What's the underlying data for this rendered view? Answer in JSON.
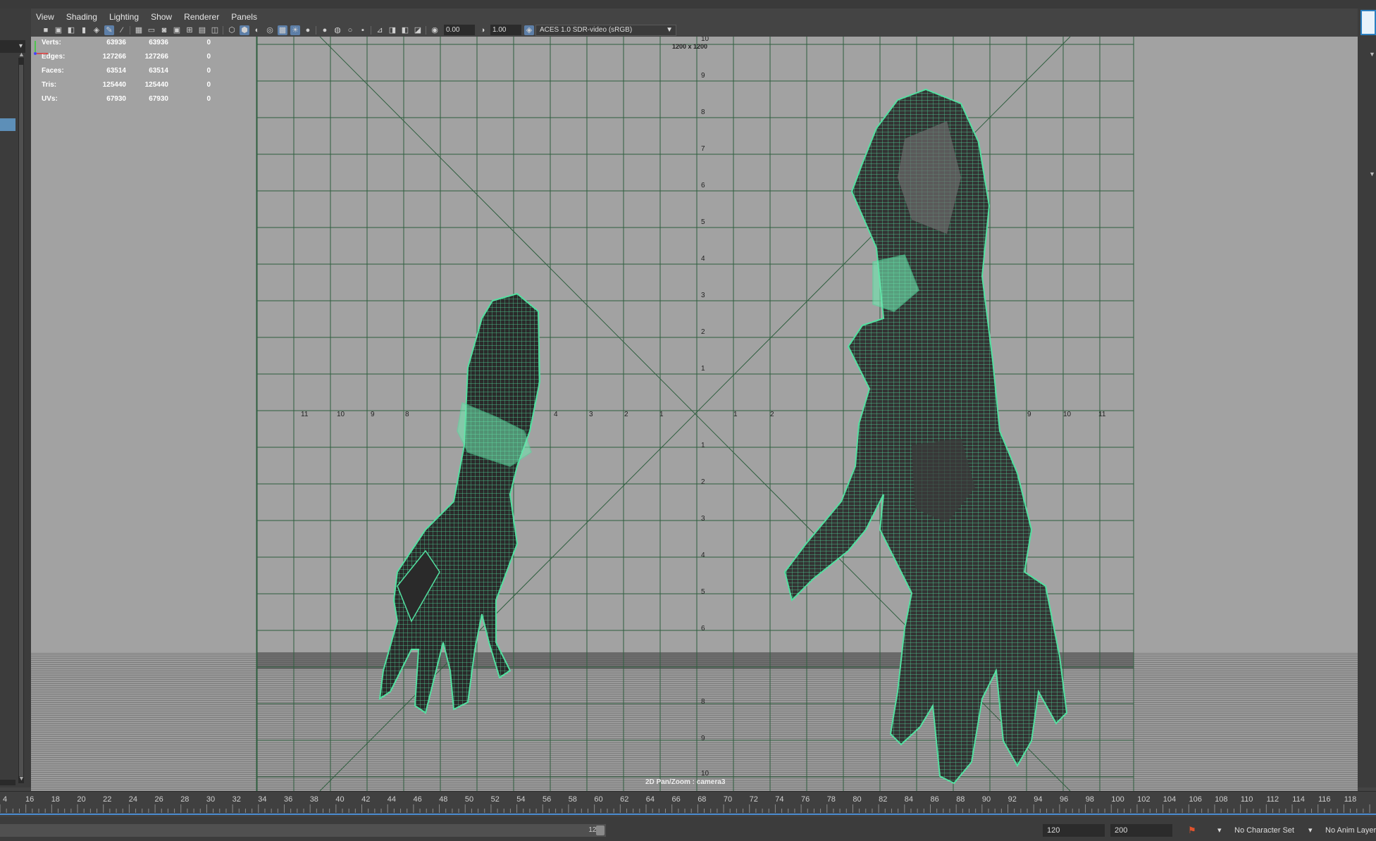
{
  "menu": [
    "View",
    "Shading",
    "Lighting",
    "Show",
    "Renderer",
    "Panels"
  ],
  "toolbar": {
    "exposure": "0.00",
    "gamma": "1.00",
    "colorspace": "ACES 1.0 SDR-video (sRGB)"
  },
  "hud": {
    "rows": [
      {
        "label": "Verts:",
        "v1": "63936",
        "v2": "63936",
        "v3": "0"
      },
      {
        "label": "Edges:",
        "v1": "127266",
        "v2": "127266",
        "v3": "0"
      },
      {
        "label": "Faces:",
        "v1": "63514",
        "v2": "63514",
        "v3": "0"
      },
      {
        "label": "Tris:",
        "v1": "125440",
        "v2": "125440",
        "v3": "0"
      },
      {
        "label": "UVs:",
        "v1": "67930",
        "v2": "67930",
        "v3": "0"
      }
    ],
    "resolution_gate": "1200 x 1200",
    "camera_label": "2D Pan/Zoom : camera3"
  },
  "grid": {
    "x_labels_left": [
      "11",
      "10",
      "9",
      "8"
    ],
    "x_labels_mid_left": [
      "4",
      "3",
      "2",
      "1"
    ],
    "x_labels_mid_right": [
      "1",
      "2"
    ],
    "x_labels_right": [
      "9",
      "10",
      "11"
    ],
    "y_labels_top": [
      "10",
      "9",
      "8",
      "7",
      "6",
      "5",
      "4",
      "3",
      "2",
      "1"
    ],
    "y_labels_bottom": [
      "1",
      "2",
      "3",
      "4",
      "5",
      "6",
      "8",
      "9",
      "10"
    ]
  },
  "timeline": {
    "frames": [
      "4",
      "16",
      "18",
      "20",
      "22",
      "24",
      "26",
      "28",
      "30",
      "32",
      "34",
      "36",
      "38",
      "40",
      "42",
      "44",
      "46",
      "48",
      "50",
      "52",
      "54",
      "56",
      "58",
      "60",
      "62",
      "64",
      "66",
      "68",
      "70",
      "72",
      "74",
      "76",
      "78",
      "80",
      "82",
      "84",
      "86",
      "88",
      "90",
      "92",
      "94",
      "96",
      "98",
      "100",
      "102",
      "104",
      "106",
      "108",
      "110",
      "112",
      "114",
      "116",
      "118"
    ]
  },
  "range": {
    "slider_end": "120",
    "playback_end": "120",
    "anim_end": "200",
    "character_set": "No Character Set",
    "anim_layer": "No Anim Layer"
  },
  "colors": {
    "wire": "#52e0a0",
    "grid": "#2e5e3e",
    "viewport_bg": "#a2a2a2",
    "accent": "#5d8fb8"
  }
}
